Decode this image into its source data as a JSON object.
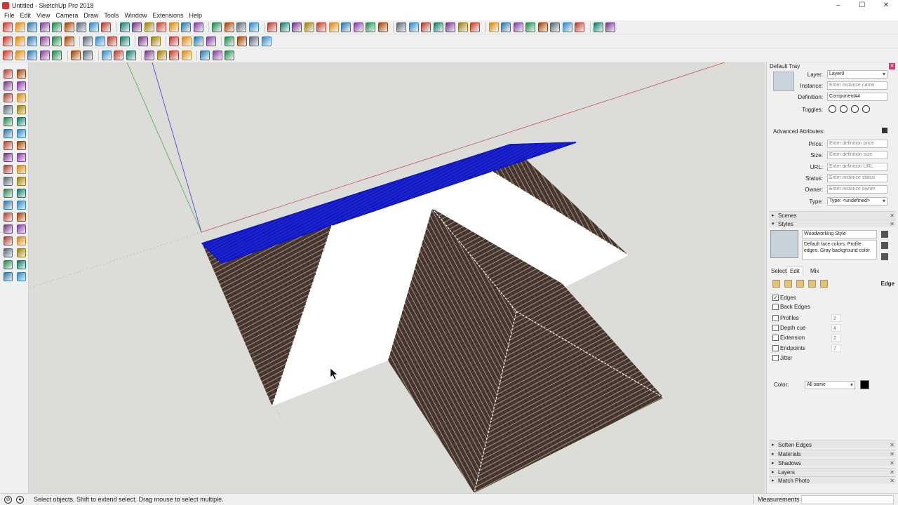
{
  "window": {
    "title": "Untitled - SketchUp Pro 2018",
    "controls": [
      "–",
      "☐",
      "✕"
    ]
  },
  "menu": [
    "File",
    "Edit",
    "View",
    "Camera",
    "Draw",
    "Tools",
    "Window",
    "Extensions",
    "Help"
  ],
  "toolbars": {
    "row1_icons": [
      "pencil-icon",
      "select-icon",
      "eraser-icon",
      "paint-bucket-icon",
      "rectangle-icon",
      "circle-icon",
      "push-pull-icon",
      "move-icon",
      "rotate-icon",
      "scale-icon",
      "offset-icon",
      "tape-measure-icon",
      "protractor-icon",
      "text-icon",
      "axes-icon",
      "3d-text-icon",
      "orbit-icon",
      "pan-icon",
      "zoom-icon",
      "zoom-window-icon",
      "zoom-extents-icon",
      "previous-view-icon",
      "next-view-icon",
      "iso-view-icon",
      "top-view-icon",
      "front-view-icon",
      "right-view-icon",
      "back-view-icon",
      "left-view-icon",
      "bottom-view-icon",
      "xray-icon",
      "back-edges-icon",
      "wireframe-icon",
      "hidden-line-icon",
      "shaded-icon",
      "textured-icon",
      "monochrome-icon",
      "line-icon",
      "arc-icon",
      "polygon-icon",
      "freehand-icon",
      "follow-me-icon",
      "intersect-icon",
      "union-icon",
      "subtract-icon",
      "warehouse-icon",
      "extension-icon"
    ],
    "row2_icons": [
      "sandbox-icon",
      "smoove-icon",
      "stamp-icon",
      "drape-icon",
      "add-detail-icon",
      "flip-edge-icon",
      "sphere-icon",
      "cylinder-icon",
      "cone-icon",
      "torus-icon",
      "component-icon",
      "group-icon",
      "section-plane-icon",
      "section-display-icon",
      "layer-icon",
      "outliner-icon",
      "scenes-icon",
      "shadows-icon",
      "fog-icon",
      "match-photo-icon"
    ],
    "row3_icons": [
      "solid-tools-icon",
      "outer-shell-icon",
      "intersect-solid-icon",
      "trim-icon",
      "split-icon",
      "dimension-icon",
      "label-icon",
      "walk-icon",
      "look-around-icon",
      "position-camera-icon",
      "section-cut-icon",
      "style-icon",
      "edge-style-icon",
      "face-style-icon",
      "background-icon",
      "watermark-icon",
      "modeling-settings-icon"
    ]
  },
  "entity_info": {
    "tray_title": "Default Tray",
    "layer_label": "Layer:",
    "layer_value": "Layer0",
    "instance_label": "Instance:",
    "instance_placeholder": "Enter instance name",
    "definition_label": "Definition:",
    "definition_value": "Component#4",
    "toggles_label": "Toggles:",
    "advanced_label": "Advanced Attributes:",
    "price_label": "Price:",
    "price_placeholder": "Enter definition price",
    "size_label": "Size:",
    "size_placeholder": "Enter definition size",
    "url_label": "URL:",
    "url_placeholder": "Enter definition URL",
    "status_label": "Status:",
    "status_placeholder": "Enter instance status",
    "owner_label": "Owner:",
    "owner_placeholder": "Enter instance owner",
    "type_label": "Type:",
    "type_value": "Type: <undefined>"
  },
  "panels": {
    "scenes": "Scenes",
    "styles": "Styles",
    "soften_edges": "Soften Edges",
    "materials": "Materials",
    "shadows": "Shadows",
    "layers": "Layers",
    "match_photo": "Match Photo"
  },
  "styles": {
    "name": "Woodworking Style",
    "description": "Default face colors. Profile edges. Gray background color.",
    "tabs": [
      "Select",
      "Edit",
      "Mix"
    ],
    "edge_title": "Edge",
    "checkboxes": [
      {
        "label": "Edges",
        "checked": true,
        "value": ""
      },
      {
        "label": "Back Edges",
        "checked": false,
        "value": ""
      },
      {
        "label": "Profiles",
        "checked": false,
        "value": "2"
      },
      {
        "label": "Depth cue",
        "checked": false,
        "value": "4"
      },
      {
        "label": "Extension",
        "checked": false,
        "value": "2"
      },
      {
        "label": "Endpoints",
        "checked": false,
        "value": "7"
      },
      {
        "label": "Jitter",
        "checked": false,
        "value": ""
      }
    ],
    "color_label": "Color:",
    "color_value": "All same",
    "color_swatch": "#000000"
  },
  "status": {
    "text": "Select objects. Shift to extend select. Drag mouse to select multiple.",
    "measurements_label": "Measurements"
  },
  "colors": {
    "roof_tile": "#3b2a22",
    "selection": "#0a14c8",
    "axis_red": "#c85050",
    "axis_green": "#4caa4c",
    "axis_blue": "#3c3cc8",
    "viewport_bg": "#dcdcd8"
  }
}
